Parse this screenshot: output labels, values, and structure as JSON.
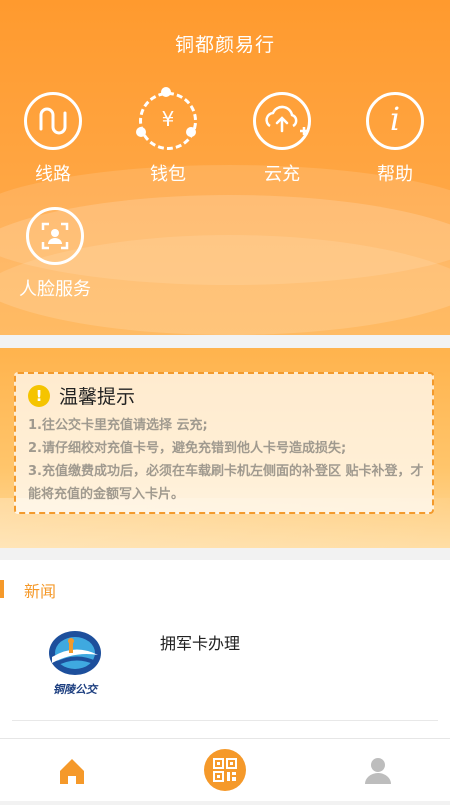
{
  "header": {
    "title": "铜都颜易行"
  },
  "menu": [
    {
      "id": "route",
      "label": "线路",
      "icon": "route-icon"
    },
    {
      "id": "wallet",
      "label": "钱包",
      "icon": "wallet-icon",
      "glyph": "¥"
    },
    {
      "id": "cloud",
      "label": "云充",
      "icon": "cloud-upload-icon"
    },
    {
      "id": "help",
      "label": "帮助",
      "icon": "info-icon",
      "glyph": "i"
    },
    {
      "id": "face",
      "label": "人脸服务",
      "icon": "face-id-icon"
    }
  ],
  "notice": {
    "title": "温馨提示",
    "icon_glyph": "!",
    "lines": [
      "1.往公交卡里充值请选择 云充;",
      "2.请仔细校对充值卡号，避免充错到他人卡号造成损失;",
      "3.充值缴费成功后，必须在车载刷卡机左侧面的补登区 贴卡补登，才能将充值的金额写入卡片。"
    ]
  },
  "news": {
    "heading": "新闻",
    "items": [
      {
        "title": "拥军卡办理",
        "logo_text": "铜陵公交"
      }
    ]
  },
  "tabbar": {
    "tabs": [
      "home-icon",
      "qr-code-icon",
      "user-icon"
    ]
  },
  "colors": {
    "accent": "#ff9a2e",
    "notice_border": "#f39a2c",
    "warning": "#f5c400"
  }
}
